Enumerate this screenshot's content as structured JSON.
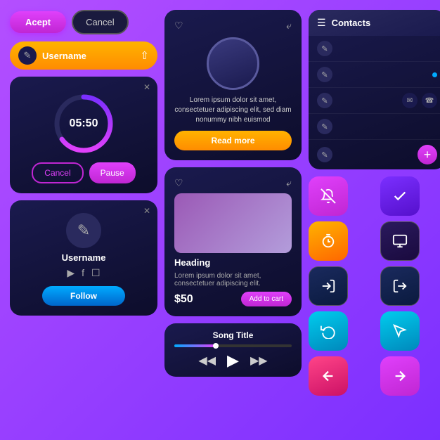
{
  "buttons": {
    "accept_label": "Acept",
    "cancel_label": "Cancel",
    "username_label": "Username",
    "timer_cancel_label": "Cancel",
    "timer_pause_label": "Pause",
    "follow_label": "Follow",
    "read_more_label": "Read more",
    "add_cart_label": "Add to cart"
  },
  "timer": {
    "time": "05:50",
    "progress": 0.65
  },
  "profile": {
    "username": "Username"
  },
  "media_card": {
    "description": "Lorem ipsum dolor sit amet, consectetuer adipiscing elit, sed diam nonummy nibh euismod"
  },
  "shop_card": {
    "heading": "Heading",
    "description": "Lorem ipsum dolor sit amet, consectetuer adipiscing elit.",
    "price": "$50"
  },
  "music": {
    "title": "Song Title",
    "progress": 35
  },
  "contacts": {
    "title": "Contacts",
    "items": [
      {
        "name": "",
        "dot": "none",
        "extra": "none"
      },
      {
        "name": "",
        "dot": "blue",
        "extra": "none"
      },
      {
        "name": "",
        "dot": "none",
        "extra": "mail-phone"
      },
      {
        "name": "",
        "dot": "none",
        "extra": "none"
      },
      {
        "name": "",
        "dot": "none",
        "extra": "add"
      }
    ]
  },
  "icon_buttons": [
    {
      "icon": "🔔",
      "label": "notification-off",
      "style": "pink"
    },
    {
      "icon": "✓",
      "label": "check-mark",
      "style": "purple"
    },
    {
      "icon": "⏱",
      "label": "timer",
      "style": "orange"
    },
    {
      "icon": "⬜",
      "label": "screen",
      "style": "dark-purple"
    },
    {
      "icon": "→",
      "label": "login",
      "style": "dark-blue"
    },
    {
      "icon": "→",
      "label": "logout",
      "style": "dark-blue"
    },
    {
      "icon": "🔄",
      "label": "refresh",
      "style": "cyan"
    },
    {
      "icon": "↖",
      "label": "cursor",
      "style": "cyan"
    },
    {
      "icon": "←",
      "label": "back",
      "style": "pink-light"
    },
    {
      "icon": "→",
      "label": "forward",
      "style": "pink2"
    }
  ]
}
